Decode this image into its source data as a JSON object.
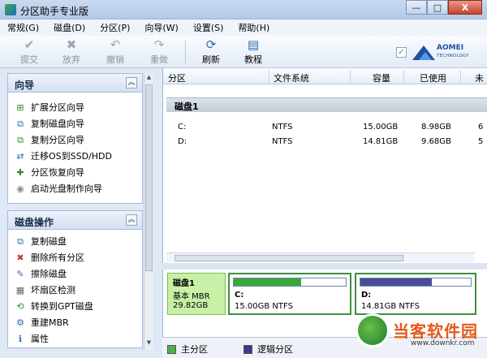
{
  "window": {
    "title": "分区助手专业版",
    "minimize_glyph": "—",
    "maximize_glyph": "□",
    "close_glyph": "X"
  },
  "menu": [
    "常规(G)",
    "磁盘(D)",
    "分区(P)",
    "向导(W)",
    "设置(S)",
    "帮助(H)"
  ],
  "toolbar": {
    "commit": "提交",
    "discard": "放弃",
    "undo": "撤销",
    "redo": "重做",
    "refresh": "刷新",
    "tutorial": "教程"
  },
  "logo": {
    "name": "AOMEI",
    "sub": "TECHNOLOGY"
  },
  "wizard_panel": {
    "title": "向导",
    "items": [
      {
        "label": "扩展分区向导",
        "icon": "extend-partition-icon"
      },
      {
        "label": "复制磁盘向导",
        "icon": "copy-disk-icon"
      },
      {
        "label": "复制分区向导",
        "icon": "copy-partition-icon"
      },
      {
        "label": "迁移OS到SSD/HDD",
        "icon": "migrate-os-icon"
      },
      {
        "label": "分区恢复向导",
        "icon": "partition-recovery-icon"
      },
      {
        "label": "启动光盘制作向导",
        "icon": "boot-disc-icon"
      }
    ]
  },
  "ops_panel": {
    "title": "磁盘操作",
    "items": [
      {
        "label": "复制磁盘",
        "icon": "copy-disk-icon"
      },
      {
        "label": "删除所有分区",
        "icon": "delete-all-icon"
      },
      {
        "label": "擦除磁盘",
        "icon": "wipe-disk-icon"
      },
      {
        "label": "坏扇区检测",
        "icon": "bad-sector-icon"
      },
      {
        "label": "转换到GPT磁盘",
        "icon": "convert-gpt-icon"
      },
      {
        "label": "重建MBR",
        "icon": "rebuild-mbr-icon"
      },
      {
        "label": "属性",
        "icon": "properties-icon"
      }
    ]
  },
  "table": {
    "columns": [
      "分区",
      "文件系统",
      "容量",
      "已使用",
      "未"
    ],
    "disk_label": "磁盘1",
    "rows": [
      {
        "partition": "C:",
        "fs": "NTFS",
        "capacity": "15.00GB",
        "used": "8.98GB",
        "unused": "6"
      },
      {
        "partition": "D:",
        "fs": "NTFS",
        "capacity": "14.81GB",
        "used": "9.68GB",
        "unused": "5"
      }
    ]
  },
  "disk_map": {
    "disk_name": "磁盘1",
    "disk_type": "基本 MBR",
    "disk_size": "29.82GB",
    "partitions": [
      {
        "letter": "C:",
        "info": "15.00GB NTFS",
        "used_fraction": 0.6,
        "color": "#3aa83a"
      },
      {
        "letter": "D:",
        "info": "14.81GB NTFS",
        "used_fraction": 0.65,
        "color": "#4a4a9a"
      }
    ]
  },
  "legend": [
    {
      "label": "主分区",
      "color": "#4caf50"
    },
    {
      "label": "逻辑分区",
      "color": "#3a3a8a"
    }
  ],
  "watermark": {
    "text": "当客软件园",
    "url": "www.downkr.com"
  }
}
